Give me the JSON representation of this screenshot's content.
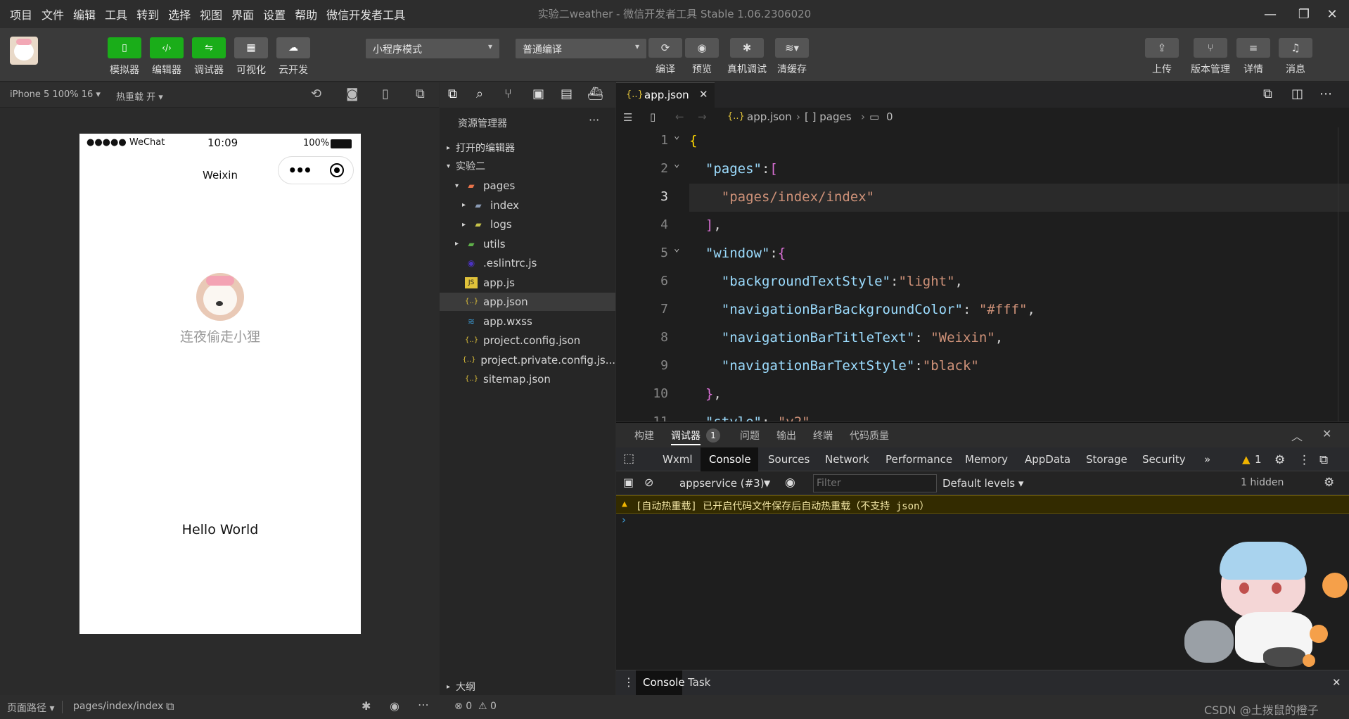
{
  "menu": [
    "项目",
    "文件",
    "编辑",
    "工具",
    "转到",
    "选择",
    "视图",
    "界面",
    "设置",
    "帮助",
    "微信开发者工具"
  ],
  "window_title": "实验二weather - 微信开发者工具 Stable 1.06.2306020",
  "toolbar": {
    "left_buttons": [
      {
        "label": "模拟器",
        "icon": "phone-icon",
        "style": "green"
      },
      {
        "label": "编辑器",
        "icon": "code-icon",
        "style": "green"
      },
      {
        "label": "调试器",
        "icon": "debug-icon",
        "style": "green"
      },
      {
        "label": "可视化",
        "icon": "layout-icon",
        "style": "gray"
      },
      {
        "label": "云开发",
        "icon": "cloud-icon",
        "style": "gray"
      }
    ],
    "mode_select": "小程序模式",
    "compile_select": "普通编译",
    "mid_buttons": [
      {
        "label": "编译",
        "icon": "refresh-icon"
      },
      {
        "label": "预览",
        "icon": "eye-icon"
      },
      {
        "label": "真机调试",
        "icon": "bug-icon"
      },
      {
        "label": "清缓存",
        "icon": "layers-icon"
      }
    ],
    "right_buttons": [
      {
        "label": "上传",
        "icon": "upload-icon"
      },
      {
        "label": "版本管理",
        "icon": "branch-icon"
      },
      {
        "label": "详情",
        "icon": "menu-icon"
      },
      {
        "label": "消息",
        "icon": "bell-icon"
      }
    ]
  },
  "simulator": {
    "device": "iPhone 5 100% 16",
    "hot_reload": "热重载 开",
    "status_carrier": "●●●●● WeChat",
    "status_time": "10:09",
    "status_battery": "100%",
    "nav_title": "Weixin",
    "nickname": "连夜偷走小狸",
    "hello": "Hello World"
  },
  "explorer": {
    "title": "资源管理器",
    "open_editors": "打开的编辑器",
    "project": "实验二",
    "outline": "大纲",
    "tree": [
      {
        "name": "pages",
        "depth": 1,
        "arrow": "▾",
        "icon": "folder-open-icon",
        "icolor": "#e8734a"
      },
      {
        "name": "index",
        "depth": 2,
        "arrow": "▸",
        "icon": "folder-icon",
        "icolor": "#8a9bb5"
      },
      {
        "name": "logs",
        "depth": 2,
        "arrow": "▸",
        "icon": "folder-icon",
        "icolor": "#c7c34a"
      },
      {
        "name": "utils",
        "depth": 1,
        "arrow": "▸",
        "icon": "folder-icon",
        "icolor": "#5fb04a"
      },
      {
        "name": ".eslintrc.js",
        "depth": 1,
        "arrow": "",
        "icon": "eslint-icon",
        "icolor": "#4b32c3"
      },
      {
        "name": "app.js",
        "depth": 1,
        "arrow": "",
        "icon": "js-icon",
        "icolor": "#e0c23a"
      },
      {
        "name": "app.json",
        "depth": 1,
        "arrow": "",
        "icon": "json-icon",
        "icolor": "#e0c23a",
        "selected": true
      },
      {
        "name": "app.wxss",
        "depth": 1,
        "arrow": "",
        "icon": "css-icon",
        "icolor": "#3c9cd6"
      },
      {
        "name": "project.config.json",
        "depth": 1,
        "arrow": "",
        "icon": "json-icon",
        "icolor": "#e0c23a"
      },
      {
        "name": "project.private.config.js...",
        "depth": 1,
        "arrow": "",
        "icon": "json-icon",
        "icolor": "#e0c23a"
      },
      {
        "name": "sitemap.json",
        "depth": 1,
        "arrow": "",
        "icon": "json-icon",
        "icolor": "#e0c23a"
      }
    ]
  },
  "editor": {
    "tab": "app.json",
    "breadcrumb": [
      "app.json",
      "[ ] pages",
      "0"
    ],
    "line_numbers": [
      "1",
      "2",
      "3",
      "4",
      "5",
      "6",
      "7",
      "8",
      "9",
      "10",
      "11"
    ]
  },
  "debugger": {
    "tabs": [
      "构建",
      "调试器",
      "问题",
      "输出",
      "终端",
      "代码质量"
    ],
    "debugger_badge": "1",
    "devtools_tabs": [
      "Wxml",
      "Console",
      "Sources",
      "Network",
      "Performance",
      "Memory",
      "AppData",
      "Storage",
      "Security"
    ],
    "warning_count": "1",
    "context": "appservice (#3)",
    "filter_placeholder": "Filter",
    "levels": "Default levels",
    "hidden": "1 hidden",
    "warning_text": "[自动热重载] 已开启代码文件保存后自动热重载（不支持 json）",
    "drawer_tabs": [
      "Console",
      "Task"
    ]
  },
  "statusbar": {
    "page_path_label": "页面路径",
    "page_path": "pages/index/index",
    "errors": "0",
    "warnings": "0",
    "watermark": "CSDN @土拨鼠的橙子"
  }
}
